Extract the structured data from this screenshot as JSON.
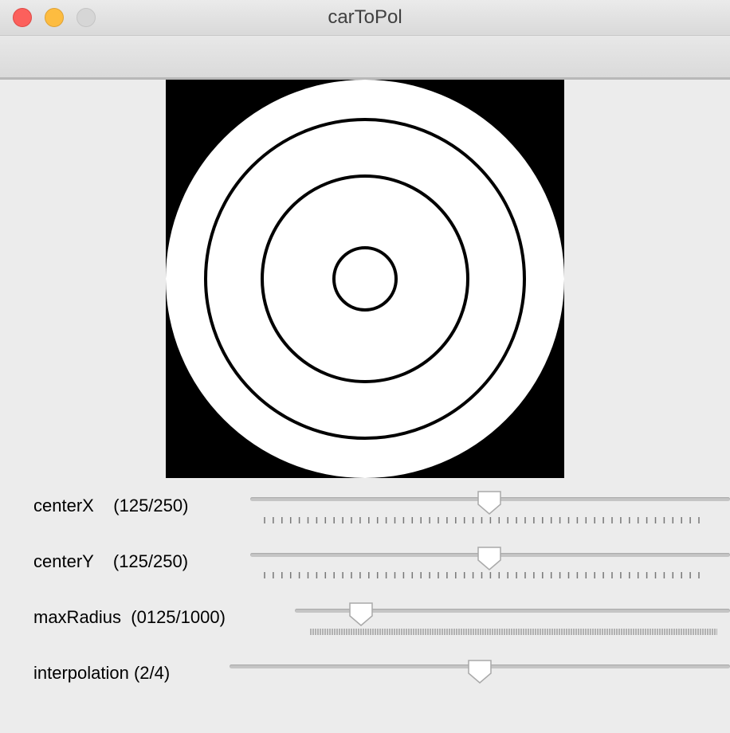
{
  "window": {
    "title": "carToPol",
    "buttons": [
      "close",
      "minimize",
      "zoom"
    ]
  },
  "image": {
    "background_color": "#000000",
    "disc_color": "#ffffff",
    "ring_color": "#000000"
  },
  "controls": [
    {
      "label": "centerX    (125/250)",
      "value": 125,
      "max": 250,
      "ticks": "sparse"
    },
    {
      "label": "centerY    (125/250)",
      "value": 125,
      "max": 250,
      "ticks": "sparse"
    },
    {
      "label": "maxRadius  (0125/1000)",
      "value": 125,
      "max": 1000,
      "ticks": "dense"
    },
    {
      "label": "interpolation (2/4)",
      "value": 2,
      "max": 4,
      "ticks": "none"
    }
  ]
}
